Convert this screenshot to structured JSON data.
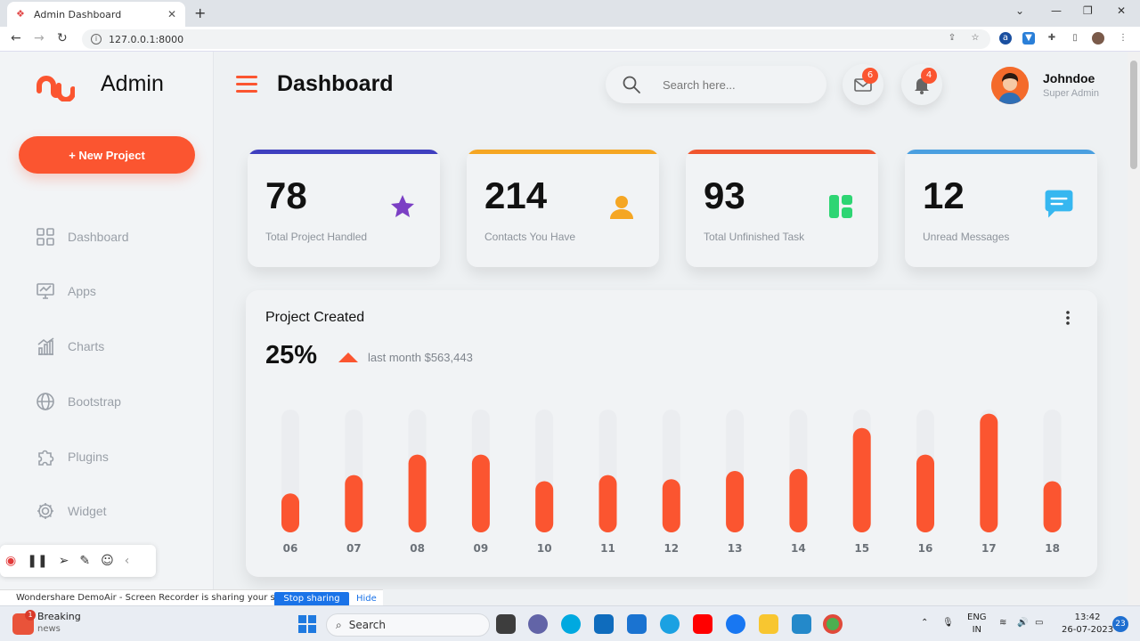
{
  "browser": {
    "tab_title": "Admin Dashboard",
    "tab_close": "✕",
    "new_tab": "+",
    "url": "127.0.0.1:8000",
    "nav": {
      "back": "←",
      "forward": "→",
      "reload": "↻"
    },
    "window_controls": {
      "minimize": "⌄",
      "min": "—",
      "max": "❐",
      "close": "✕"
    }
  },
  "sidebar": {
    "brand": "Admin",
    "new_project_label": "+ New Project",
    "items": [
      {
        "label": "Dashboard",
        "icon": "grid-icon"
      },
      {
        "label": "Apps",
        "icon": "monitor-icon"
      },
      {
        "label": "Charts",
        "icon": "bar-chart-icon"
      },
      {
        "label": "Bootstrap",
        "icon": "globe-icon"
      },
      {
        "label": "Plugins",
        "icon": "puzzle-icon"
      },
      {
        "label": "Widget",
        "icon": "gear-icon"
      }
    ]
  },
  "header": {
    "title": "Dashboard",
    "search_placeholder": "Search here...",
    "mail_count": "6",
    "notification_count": "4",
    "user_name": "Johndoe",
    "user_role": "Super Admin"
  },
  "stats": [
    {
      "value": "78",
      "label": "Total Project Handled",
      "color": "#3f3fbf",
      "icon": "star-icon"
    },
    {
      "value": "214",
      "label": "Contacts You Have",
      "color": "#f5a623",
      "icon": "user-icon"
    },
    {
      "value": "93",
      "label": "Total Unfinished Task",
      "color": "#f0552e",
      "icon": "layout-icon"
    },
    {
      "value": "12",
      "label": "Unread Messages",
      "color": "#4a9fe0",
      "icon": "chat-icon"
    }
  ],
  "panel": {
    "title": "Project Created",
    "percent": "25%",
    "delta_text": "last month $563,443"
  },
  "chart_data": {
    "type": "bar",
    "categories": [
      "06",
      "07",
      "08",
      "09",
      "10",
      "11",
      "12",
      "13",
      "14",
      "15",
      "16",
      "17",
      "18"
    ],
    "values": [
      19,
      28,
      38,
      38,
      25,
      28,
      26,
      30,
      31,
      51,
      38,
      58,
      25
    ],
    "ylim": [
      0,
      60
    ],
    "color": "#fb5530"
  },
  "screen_share": {
    "text": "Wondershare DemoAir - Screen Recorder is sharing your screen.",
    "stop_label": "Stop sharing",
    "hide_label": "Hide"
  },
  "taskbar": {
    "news_title": "Breaking",
    "news_sub": "news",
    "news_badge": "1",
    "search_label": "Search",
    "lang": "ENG",
    "region": "IN",
    "time": "13:42",
    "date": "26-07-2023",
    "notif_count": "23"
  },
  "colors": {
    "accent": "#fb5530",
    "bg": "#eef1f3"
  }
}
